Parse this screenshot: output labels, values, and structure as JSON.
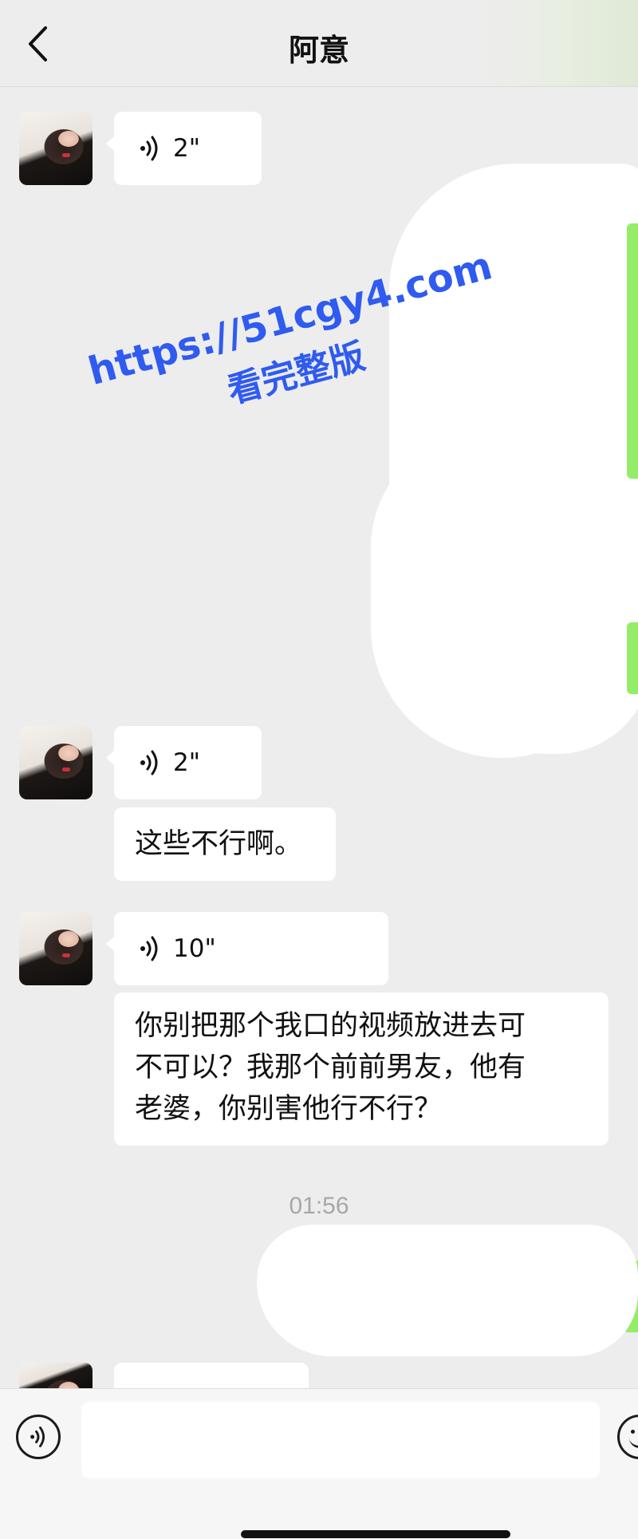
{
  "header": {
    "title": "阿意",
    "back_icon": "chevron-left-icon"
  },
  "messages": [
    {
      "type": "voice",
      "sender": "contact",
      "duration": "2\""
    },
    {
      "type": "voice",
      "sender": "contact",
      "duration": "2\""
    },
    {
      "type": "text",
      "sender": "contact",
      "text": "这些不行啊。"
    },
    {
      "type": "voice",
      "sender": "contact",
      "duration": "10\""
    },
    {
      "type": "text",
      "sender": "contact",
      "lines": [
        "你别把那个我口的视频放进去可",
        "不可以？我那个前前男友，他有",
        "老婆，你别害他行不行？"
      ]
    },
    {
      "type": "voice",
      "sender": "contact",
      "duration": ""
    }
  ],
  "timestamp": "01:56",
  "watermark": {
    "url": "https://51cgy4.com",
    "subtitle": "看完整版"
  },
  "input_bar": {
    "voice_icon": "voice-toggle-icon",
    "emoji_icon": "emoji-icon",
    "input_value": ""
  },
  "colors": {
    "background": "#ededed",
    "bubble_contact": "#ffffff",
    "bubble_self": "#95ec69",
    "watermark": "#2f5bf0"
  }
}
